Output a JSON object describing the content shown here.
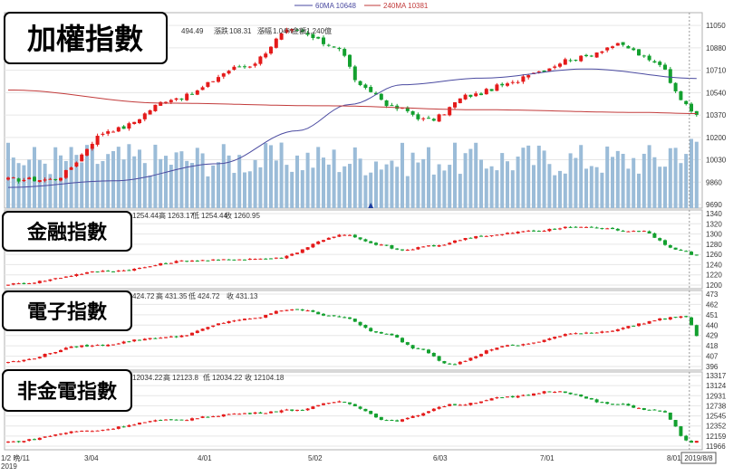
{
  "legend": {
    "ma60": {
      "label": "60MA 10648",
      "color": "#4a4aa0"
    },
    "ma240": {
      "label": "240MA 10381",
      "color": "#c23b3b"
    }
  },
  "colors": {
    "up": "#e41a1a",
    "down": "#13a02f",
    "volume": "#9bbcd8",
    "triangle": "#1c3ea0"
  },
  "x_axis": {
    "ticks": [
      {
        "label": "1/2",
        "i": 0
      },
      {
        "label": "1/2 晩/11",
        "i": 0
      },
      {
        "label": "3/04",
        "i": 24
      },
      {
        "label": "4/01",
        "i": 43
      },
      {
        "label": "5/02",
        "i": 63
      },
      {
        "label": "6/03",
        "i": 84
      },
      {
        "label": "7/01",
        "i": 104
      },
      {
        "label": "8/01",
        "i": 127
      }
    ],
    "year": "2019",
    "cursor_label": "2019/8/8"
  },
  "chart_data": [
    {
      "id": "taiex",
      "type": "candlestick",
      "title": "加權指數",
      "info": {
        "last": "494.49",
        "change_label": "漲跌",
        "change": "108.31",
        "pct_label": "漲幅",
        "pct": "1.04%",
        "amount_label": "金額",
        "amount": "1,240億"
      },
      "y_ticks": [
        11050,
        10880,
        10710,
        10540,
        10370,
        10200,
        10030,
        9860,
        9690
      ],
      "ylim": [
        9690,
        11120
      ],
      "start": 9880,
      "low": 9860,
      "peak": 11010,
      "peak_i": 54,
      "trough": 10330,
      "trough_i": 80,
      "rally": 10900,
      "rally_i": 116,
      "end": 10380,
      "ma60": {
        "label": "60MA",
        "value": 10648
      },
      "ma240": {
        "label": "240MA",
        "value": 10381
      },
      "volume": true
    },
    {
      "id": "finance",
      "type": "candlestick",
      "title": "金融指數",
      "info": {
        "last": "1254.44",
        "high_label": "高",
        "high": "1263.17",
        "low_label": "低",
        "low": "1254.44",
        "close_label": "收",
        "close": "1260.95"
      },
      "y_ticks": [
        1340,
        1320,
        1300,
        1280,
        1260,
        1240,
        1220,
        1200
      ],
      "ylim": [
        1200,
        1340
      ],
      "start": 1202,
      "peak1": 1298,
      "peak1_i": 64,
      "trough": 1268,
      "trough_i": 75,
      "high": 1314,
      "high_i": 108,
      "end": 1258
    },
    {
      "id": "electronics",
      "type": "candlestick",
      "title": "電子指數",
      "info": {
        "last": "424.72",
        "high_label": "高",
        "high": "431.35",
        "low_label": "低",
        "low": "424.72",
        "close_label": "收",
        "close": "431.13"
      },
      "y_ticks": [
        473,
        462,
        451,
        440,
        429,
        418,
        407,
        396
      ],
      "ylim": [
        396,
        473
      ],
      "start": 401,
      "peak": 457,
      "peak_i": 54,
      "trough": 399,
      "trough_i": 84,
      "rally": 449,
      "rally_i": 129,
      "end": 429
    },
    {
      "id": "nonfinance",
      "type": "candlestick",
      "title": "非金電指數",
      "info": {
        "last": "12034.22",
        "high_label": "高",
        "high": "12123.8",
        "low_label": "低",
        "low": "12034.22",
        "close_label": "收",
        "close": "12104.18"
      },
      "y_ticks": [
        13317,
        13124,
        12931,
        12738,
        12545,
        12352,
        12159,
        11966
      ],
      "ylim": [
        11966,
        13317
      ],
      "start": 12050,
      "peak": 12820,
      "peak_i": 63,
      "trough": 12450,
      "trough_i": 73,
      "high": 13020,
      "high_i": 104,
      "end": 12060
    }
  ]
}
